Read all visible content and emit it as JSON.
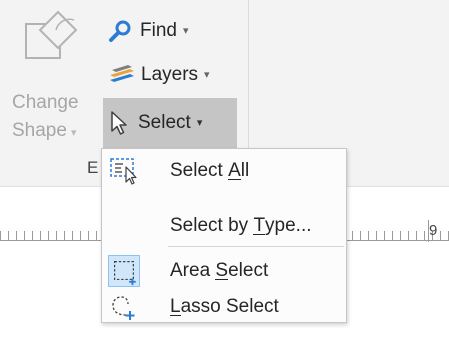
{
  "ribbon": {
    "change_shape": {
      "line1": "Change",
      "line2": "Shape",
      "caret": "▾",
      "icon": "change-shape-icon"
    },
    "find": {
      "label": "Find",
      "caret": "▾",
      "icon": "find-icon"
    },
    "layers": {
      "label": "Layers",
      "caret": "▾",
      "icon": "layers-icon"
    },
    "select": {
      "label": "Select",
      "caret": "▾",
      "icon": "pointer-icon",
      "state": "pressed"
    },
    "group_label": "E"
  },
  "ruler": {
    "number": "9"
  },
  "menu": {
    "items": [
      {
        "pre": "Select ",
        "key": "A",
        "post": "ll",
        "icon": "select-all-icon"
      },
      {
        "pre": "Select by ",
        "key": "T",
        "post": "ype...",
        "icon": ""
      },
      {
        "pre": "Area ",
        "key": "S",
        "post": "elect",
        "icon": "area-select-icon"
      },
      {
        "pre": "",
        "key": "L",
        "post": "asso Select",
        "icon": "lasso-select-icon"
      }
    ]
  },
  "colors": {
    "ribbon_bg": "#f3f3f3",
    "pressed_bg": "#c5c5c5",
    "menu_bg": "#fcfcfc",
    "accent_blue": "#2b7cd3",
    "disabled_text": "#a6a6a6"
  }
}
